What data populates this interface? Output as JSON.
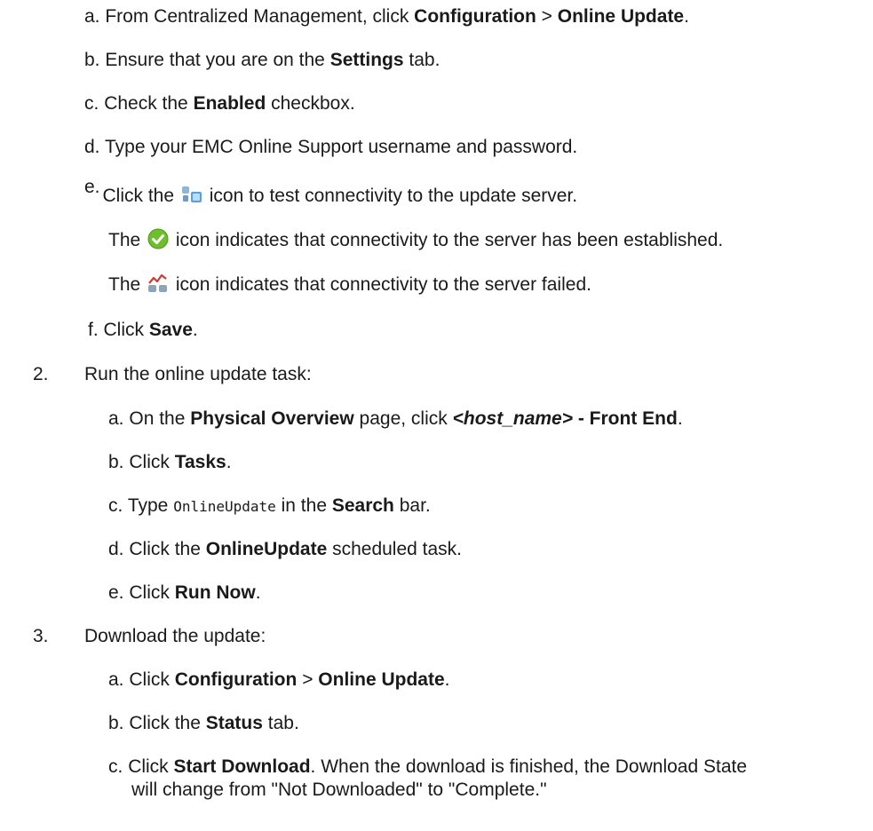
{
  "config_steps": {
    "a": {
      "letter": "a.",
      "pre": "From Centralized Management, click",
      "b1": "Configuration",
      "sep": ">",
      "b2": "Online Update",
      "post": "."
    },
    "b": {
      "letter": "b.",
      "pre": "Ensure that you are on the",
      "b1": "Settings",
      "post": "tab."
    },
    "c": {
      "letter": "c.",
      "pre": "Check the",
      "b1": "Enabled",
      "post": "checkbox."
    },
    "d": {
      "letter": "d.",
      "text": "Type your EMC Online Support username and password."
    },
    "e": {
      "letter": "e.",
      "pre": "Click the",
      "post": "icon to test connectivity to the update server.",
      "icon": "test-connectivity-icon"
    },
    "e_ok": {
      "pre": "The",
      "post": "icon indicates that connectivity to the server has been established.",
      "icon": "green-check-icon"
    },
    "e_fail": {
      "pre": "The",
      "post": "icon indicates that connectivity to the server failed.",
      "icon": "connection-failed-icon"
    },
    "f": {
      "letter": "f.",
      "pre": "Click",
      "b1": "Save",
      "post": "."
    }
  },
  "step2": {
    "num": "2.",
    "title": "Run the online update task:",
    "a": {
      "letter": "a.",
      "pre": "On the",
      "b1": "Physical Overview",
      "mid": "page, click",
      "bi": "<host_name>",
      "b2": "- Front End",
      "post": "."
    },
    "b": {
      "letter": "b.",
      "pre": "Click",
      "b1": "Tasks",
      "post": "."
    },
    "c": {
      "letter": "c.",
      "pre": "Type",
      "code": "OnlineUpdate",
      "mid": "in the",
      "b1": "Search",
      "post": "bar."
    },
    "d": {
      "letter": "d.",
      "pre": "Click the",
      "b1": "OnlineUpdate",
      "post": "scheduled task."
    },
    "e": {
      "letter": "e.",
      "pre": "Click",
      "b1": "Run Now",
      "post": "."
    }
  },
  "step3": {
    "num": "3.",
    "title": "Download the update:",
    "a": {
      "letter": "a.",
      "pre": "Click",
      "b1": "Configuration",
      "sep": ">",
      "b2": "Online Update",
      "post": "."
    },
    "b": {
      "letter": "b.",
      "pre": "Click the",
      "b1": "Status",
      "post": "tab."
    },
    "c": {
      "letter": "c.",
      "pre": "Click",
      "b1": "Start Download",
      "post": ". When the download is finished, the Download State",
      "line2": "will change from \"Not Downloaded\" to \"Complete.\""
    }
  },
  "colors": {
    "text": "#1a1a1a",
    "check_green": "#6fbf2c"
  }
}
